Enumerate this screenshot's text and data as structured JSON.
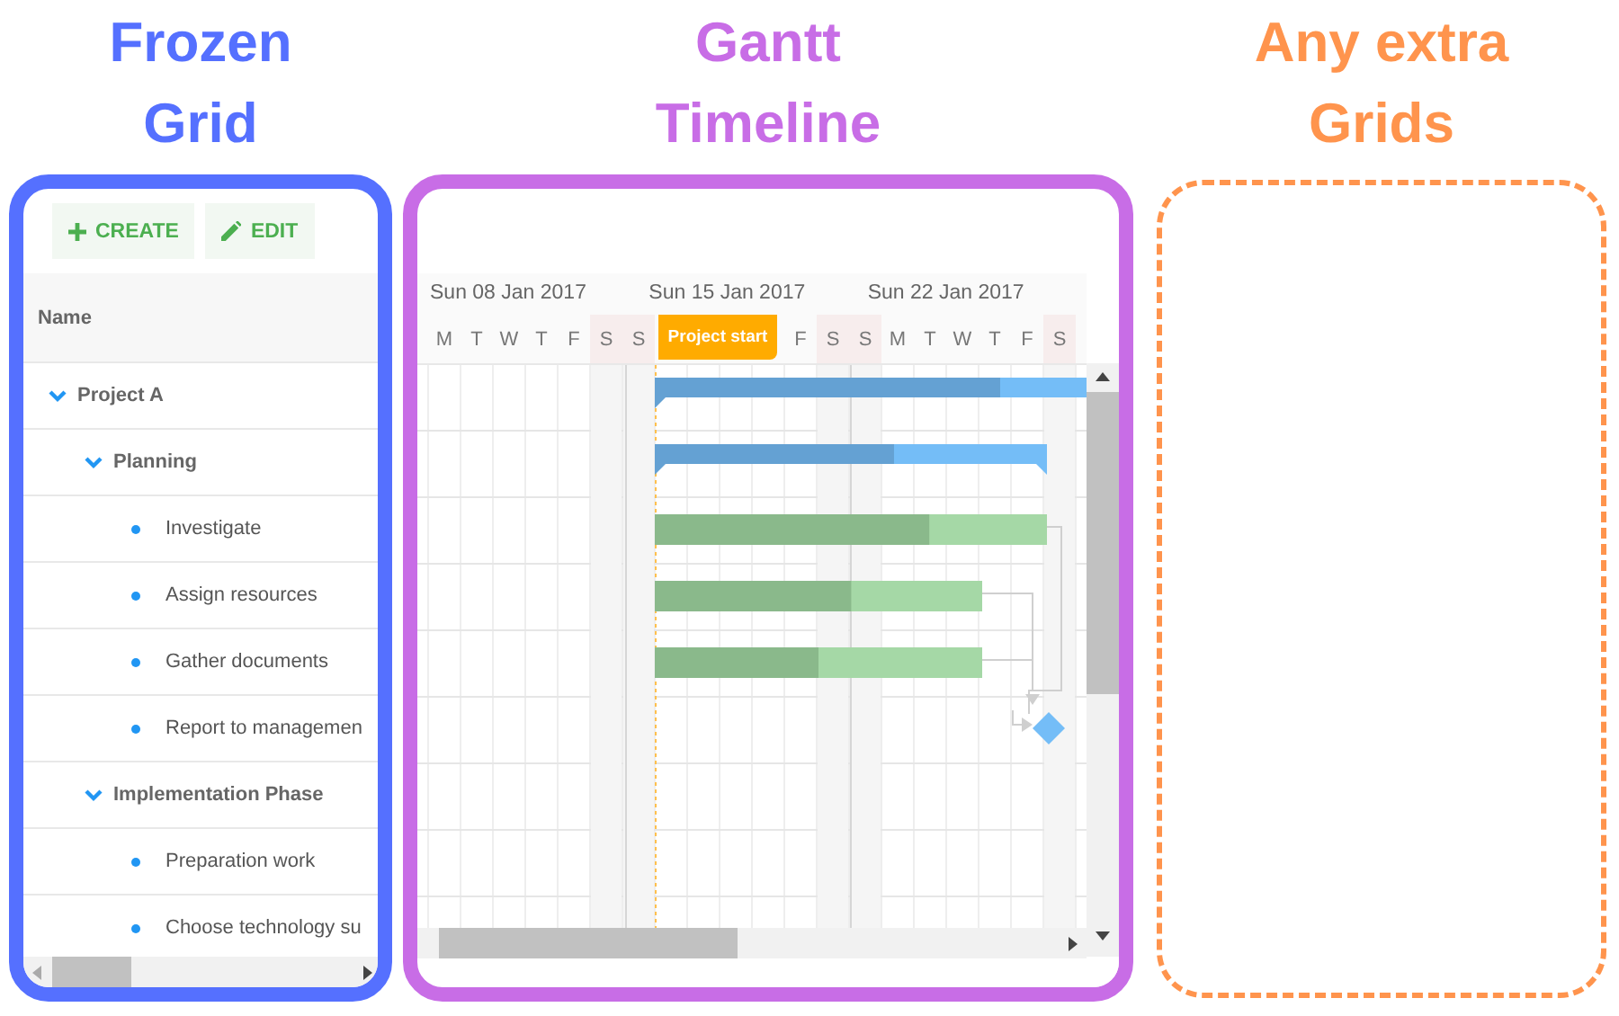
{
  "panels": [
    {
      "kind": "frozen_grid",
      "title": "Frozen Grid",
      "color": "#5570ff"
    },
    {
      "kind": "gantt",
      "title": "Gantt Timeline",
      "color": "#c86de6"
    },
    {
      "kind": "extra",
      "title": "Any extra Grids",
      "color": "#ff944d"
    }
  ],
  "grid": {
    "toolbar": [
      {
        "kind": "create",
        "label": "CREATE"
      },
      {
        "kind": "edit",
        "label": "EDIT"
      }
    ],
    "column": "Name",
    "tasks": [
      {
        "name": "Project A",
        "expanded": true,
        "children": [
          {
            "name": "Planning",
            "expanded": true,
            "children": [
              {
                "name": "Investigate"
              },
              {
                "name": "Assign resources"
              },
              {
                "name": "Gather documents"
              },
              {
                "name": "Report to managemen"
              }
            ]
          },
          {
            "name": "Implementation Phase",
            "expanded": true,
            "children": [
              {
                "name": "Preparation work"
              },
              {
                "name": "Choose technology su"
              }
            ]
          }
        ]
      }
    ]
  },
  "timeline": {
    "weeks": [
      "Sun 08 Jan 2017",
      "Sun 15 Jan 2017",
      "Sun 22 Jan 2017"
    ],
    "days": [
      {
        "kind": "day",
        "label": "M",
        "weekend": false
      },
      {
        "kind": "day",
        "label": "T",
        "weekend": false
      },
      {
        "kind": "day",
        "label": "W",
        "weekend": false
      },
      {
        "kind": "day",
        "label": "T",
        "weekend": false
      },
      {
        "kind": "day",
        "label": "F",
        "weekend": false
      },
      {
        "kind": "day",
        "label": "S",
        "weekend": true
      },
      {
        "kind": "day",
        "label": "S",
        "weekend": true
      },
      {
        "kind": "marker",
        "label": "Project start"
      },
      {
        "kind": "day",
        "label": "F",
        "weekend": false
      },
      {
        "kind": "day",
        "label": "S",
        "weekend": true
      },
      {
        "kind": "day",
        "label": "S",
        "weekend": true
      },
      {
        "kind": "day",
        "label": "M",
        "weekend": false
      },
      {
        "kind": "day",
        "label": "T",
        "weekend": false
      },
      {
        "kind": "day",
        "label": "W",
        "weekend": false
      },
      {
        "kind": "day",
        "label": "T",
        "weekend": false
      },
      {
        "kind": "day",
        "label": "F",
        "weekend": false
      },
      {
        "kind": "day",
        "label": "S",
        "weekend": true
      }
    ],
    "bars": [
      {
        "kind": "summary",
        "level": 0.8
      },
      {
        "kind": "summary",
        "level": 0.61
      },
      {
        "kind": "task",
        "level": 0.7
      },
      {
        "kind": "task",
        "level": 0.6
      },
      {
        "kind": "task",
        "level": 0.5
      },
      {
        "kind": "milestone"
      }
    ]
  }
}
